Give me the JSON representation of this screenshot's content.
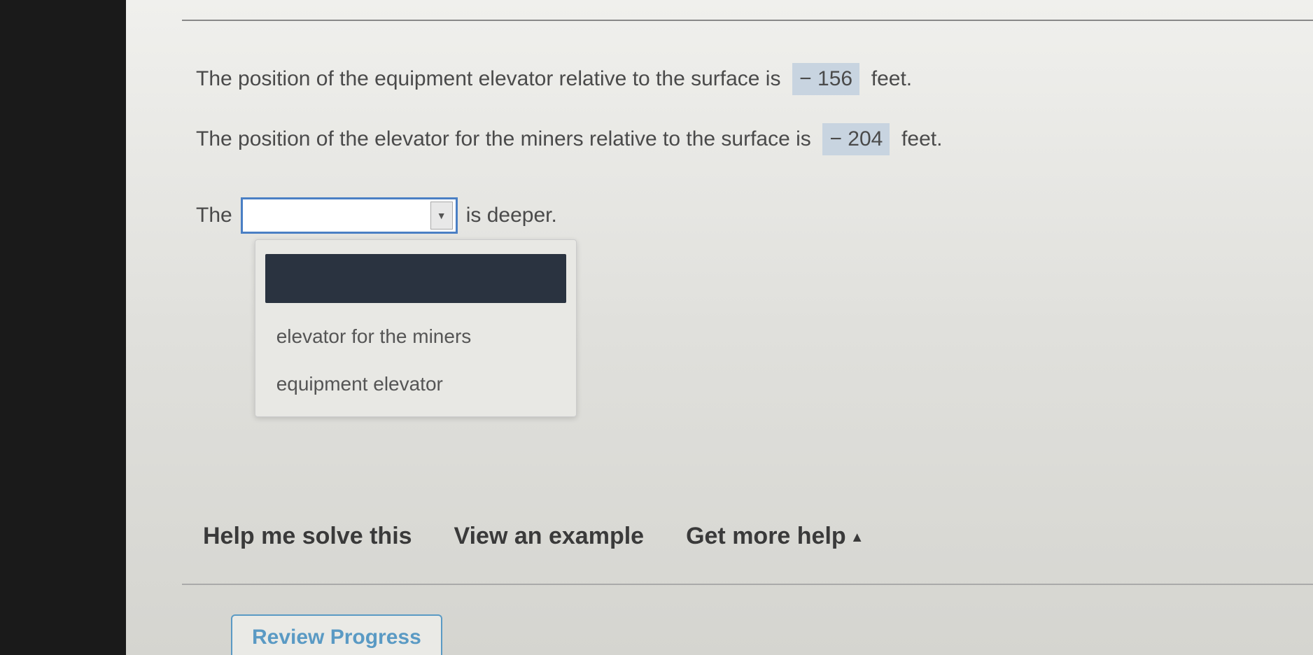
{
  "statements": {
    "line1_prefix": "The position of the equipment elevator relative to the surface is",
    "line1_value": "− 156",
    "line1_suffix": "feet.",
    "line2_prefix": "The position of the elevator for the miners relative to the surface is",
    "line2_value": "− 204",
    "line2_suffix": "feet."
  },
  "answer": {
    "prefix": "The",
    "suffix": "is deeper."
  },
  "dropdown": {
    "options": [
      "",
      "elevator for the miners",
      "equipment elevator"
    ]
  },
  "help": {
    "solve": "Help me solve this",
    "example": "View an example",
    "more": "Get more help"
  },
  "footer": {
    "review": "Review Progress"
  }
}
